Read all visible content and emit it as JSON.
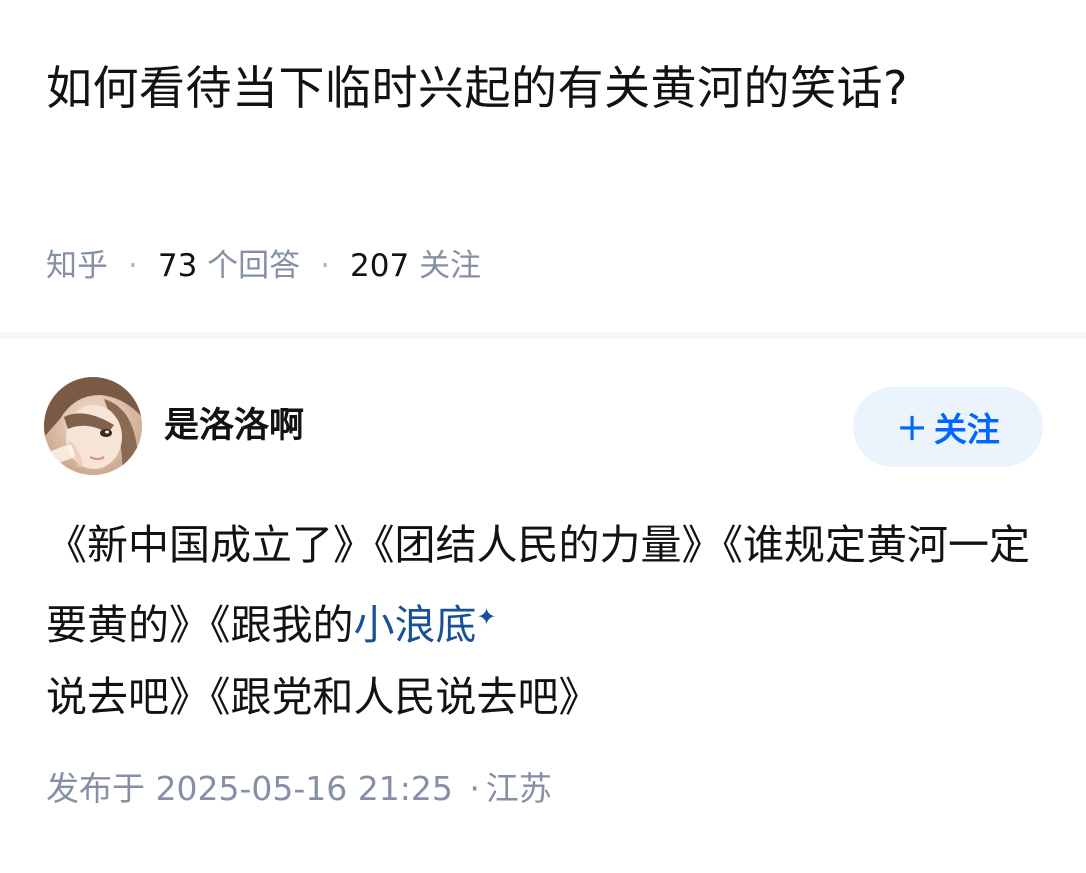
{
  "question": {
    "title": "如何看待当下临时兴起的有关黄河的笑话?",
    "source": "知乎",
    "answer_count": "73",
    "answer_label": "个回答",
    "follower_count": "207",
    "follower_label": "关注"
  },
  "answer": {
    "author_name": "是洛洛啊",
    "follow_button_label": "关注",
    "follow_button_plus": "+",
    "content_before_link": "《新中国成立了》《团结人民的力量》《谁规定黄河一定要黄的》《跟我的",
    "content_link_text": "小浪底",
    "content_link_icon": "✦",
    "content_after_link": "说去吧》《跟党和人民说去吧》",
    "publish_prefix": "发布于",
    "publish_datetime": "2025-05-16 21:25",
    "publish_separator": "·",
    "publish_location": "江苏"
  },
  "colors": {
    "accent": "#0066ff",
    "follow_bg": "#ebf3fd",
    "link": "#175199",
    "muted": "#8590a6",
    "text": "#121212"
  },
  "icons": {
    "avatar": "anime-girl-avatar",
    "link_badge": "sparkle-icon",
    "follow": "plus-icon"
  }
}
